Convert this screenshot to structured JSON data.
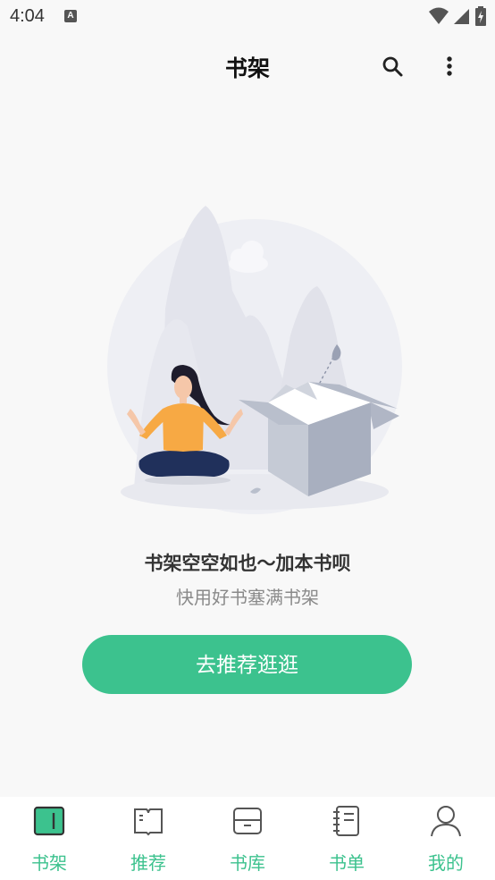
{
  "status_bar": {
    "time": "4:04",
    "notification_badge": "A"
  },
  "app_bar": {
    "title": "书架",
    "icons": [
      "search-icon",
      "more-vert-icon"
    ]
  },
  "empty_state": {
    "title": "书架空空如也～加本书呗",
    "subtitle": "快用好书塞满书架",
    "button_label": "去推荐逛逛"
  },
  "bottom_nav": {
    "items": [
      {
        "label": "书架",
        "icon": "bookshelf-icon",
        "selected": true
      },
      {
        "label": "推荐",
        "icon": "open-book-icon",
        "selected": false
      },
      {
        "label": "书库",
        "icon": "library-icon",
        "selected": false
      },
      {
        "label": "书单",
        "icon": "booklist-icon",
        "selected": false
      },
      {
        "label": "我的",
        "icon": "profile-icon",
        "selected": false
      }
    ]
  },
  "colors": {
    "accent": "#3cc28e",
    "background": "#f8f8f8",
    "nav_background": "#ffffff",
    "icon_stroke": "#555555"
  }
}
